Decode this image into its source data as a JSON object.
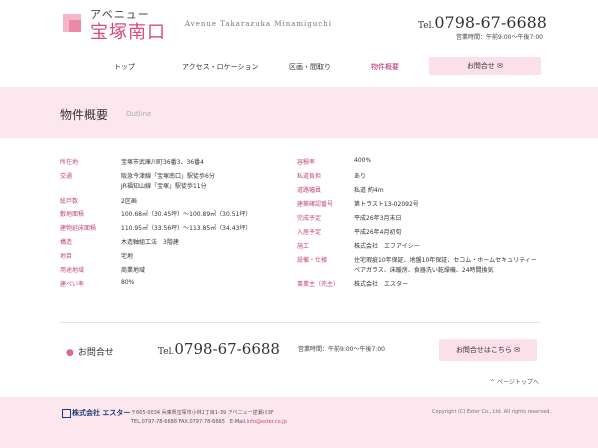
{
  "header": {
    "logo_small": "アベニュー",
    "logo_large": "宝塚南口",
    "logo_en": "Avenue Takarazuka Minamiguchi",
    "tel_prefix": "Tel.",
    "tel_number": "0798-67-6688",
    "hours": "営業時間：午前9:00〜午後7:00"
  },
  "nav": {
    "items": [
      "トップ",
      "アクセス・ロケーション",
      "区画・間取り",
      "物件概要"
    ],
    "contact_button": "お問合せ"
  },
  "page": {
    "title": "物件概要",
    "title_en": "Outline"
  },
  "outline": {
    "left": [
      {
        "label": "所在地",
        "value": "宝塚市武庫川町36番3、36番4"
      },
      {
        "label": "交通",
        "value": "阪急今津線「宝塚南口」駅徒歩6分"
      },
      {
        "label": "",
        "value": "JR福知山線「宝塚」駅徒歩11分"
      },
      {
        "label": "総戸数",
        "value": "2区画"
      },
      {
        "label": "敷地面積",
        "value": "100.68㎡（30.45坪）〜100.89㎡（30.51坪）"
      },
      {
        "label": "建物延床面積",
        "value": "110.95㎡（33.56坪）〜113.85㎡（34.43坪）"
      },
      {
        "label": "構造",
        "value": "木造軸組工法　3階建"
      },
      {
        "label": "地目",
        "value": "宅地"
      },
      {
        "label": "用途地域",
        "value": "商業地域"
      },
      {
        "label": "建ぺい率",
        "value": "80%"
      }
    ],
    "right": [
      {
        "label": "容積率",
        "value": "400%"
      },
      {
        "label": "私道負担",
        "value": "あり"
      },
      {
        "label": "道路幅員",
        "value": "私道 約4m"
      },
      {
        "label": "建築確認番号",
        "value": "第トラスト13-02092号"
      },
      {
        "label": "完成予定",
        "value": "平成26年3月末日"
      },
      {
        "label": "入居予定",
        "value": "平成26年4月初旬"
      },
      {
        "label": "施工",
        "value": "株式会社　エフアイシー"
      },
      {
        "label": "設備・仕様",
        "value": "住宅瑕疵10年保証、地盤10年保証、セコム・ホームセキュリティー"
      },
      {
        "label": "",
        "value": "ペアガラス、床暖房、食器洗い乾燥機、24時間換気"
      },
      {
        "label": "事業主（売主）",
        "value": "株式会社　エスター"
      }
    ]
  },
  "contact": {
    "label": "お問合せ",
    "tel_prefix": "Tel.",
    "tel_number": "0798-67-6688",
    "hours": "営業時間：午前9:00〜午後7:00",
    "button": "お問合せはこちら",
    "page_top": "ページトップへ"
  },
  "footer": {
    "logo": "株式会社 エスター",
    "address": "〒665-0034 兵庫県宝塚市小林1丁目1-39 アベニュー逆瀬川3F",
    "tel_fax": "TEL.0797-78-6688 FAX.0797-78-6665　E-Mail.",
    "email": "info@ester.co.jp",
    "copyright": "Copyright (C) Ester Co., Ltd. All rights reserved."
  }
}
